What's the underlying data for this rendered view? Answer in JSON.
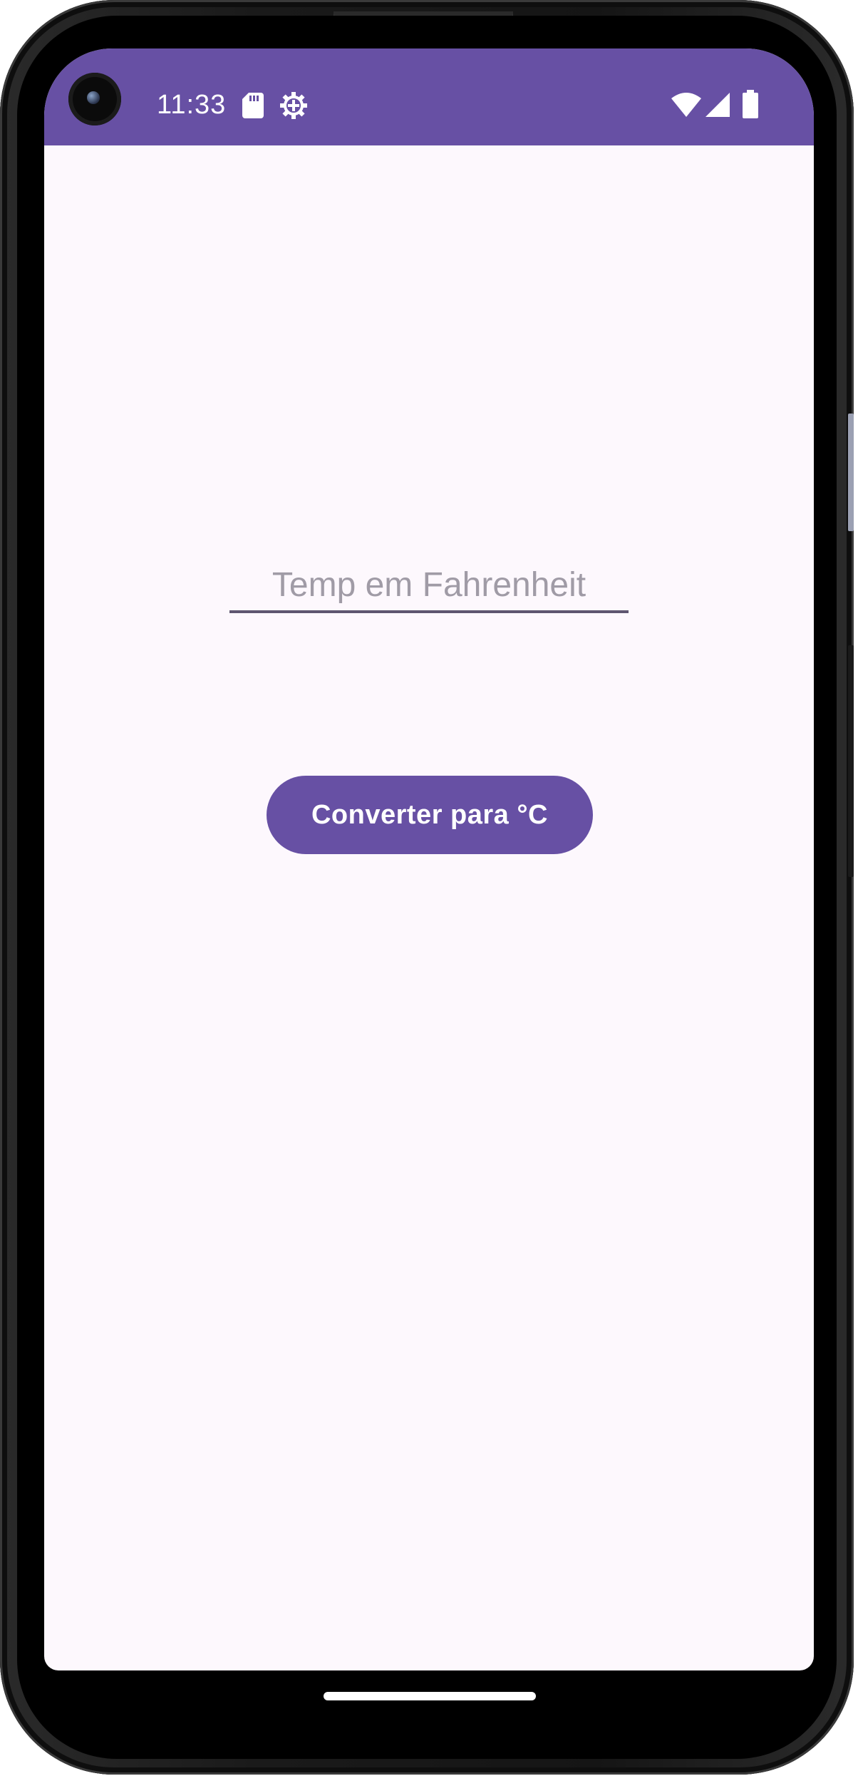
{
  "status_bar": {
    "time": "11:33",
    "background_color": "#6750a4",
    "icons": [
      "sd-card-icon",
      "gear-icon",
      "wifi-icon",
      "signal-icon",
      "battery-icon"
    ]
  },
  "form": {
    "temperature_input": {
      "placeholder": "Temp em Fahrenheit",
      "value": ""
    },
    "convert_button": {
      "label": "Converter para °C",
      "color": "#6750a4"
    }
  },
  "theme": {
    "screen_background": "#fdf8fd",
    "accent": "#6750a4",
    "underline": "#5f5670"
  }
}
